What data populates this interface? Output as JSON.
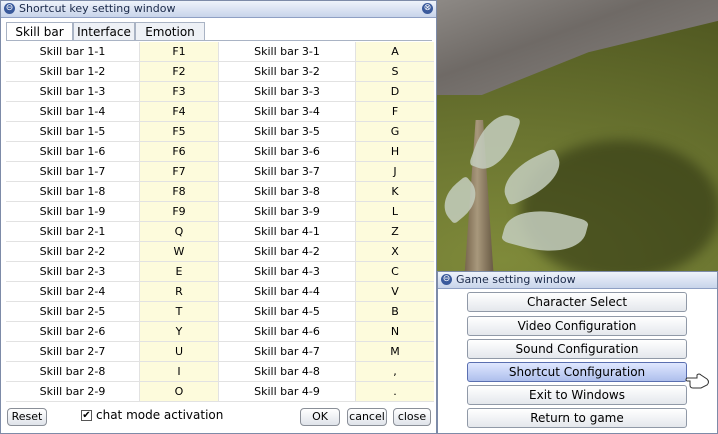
{
  "shortcut_window": {
    "title": "Shortcut key setting window",
    "tabs": [
      "Skill bar",
      "Interface",
      "Emotion"
    ],
    "active_tab": "Skill bar",
    "rows": [
      [
        "Skill bar 1-1",
        "F1",
        "Skill bar 3-1",
        "A"
      ],
      [
        "Skill bar 1-2",
        "F2",
        "Skill bar 3-2",
        "S"
      ],
      [
        "Skill bar 1-3",
        "F3",
        "Skill bar 3-3",
        "D"
      ],
      [
        "Skill bar 1-4",
        "F4",
        "Skill bar 3-4",
        "F"
      ],
      [
        "Skill bar 1-5",
        "F5",
        "Skill bar 3-5",
        "G"
      ],
      [
        "Skill bar 1-6",
        "F6",
        "Skill bar 3-6",
        "H"
      ],
      [
        "Skill bar 1-7",
        "F7",
        "Skill bar 3-7",
        "J"
      ],
      [
        "Skill bar 1-8",
        "F8",
        "Skill bar 3-8",
        "K"
      ],
      [
        "Skill bar 1-9",
        "F9",
        "Skill bar 3-9",
        "L"
      ],
      [
        "Skill bar 2-1",
        "Q",
        "Skill bar 4-1",
        "Z"
      ],
      [
        "Skill bar 2-2",
        "W",
        "Skill bar 4-2",
        "X"
      ],
      [
        "Skill bar 2-3",
        "E",
        "Skill bar 4-3",
        "C"
      ],
      [
        "Skill bar 2-4",
        "R",
        "Skill bar 4-4",
        "V"
      ],
      [
        "Skill bar 2-5",
        "T",
        "Skill bar 4-5",
        "B"
      ],
      [
        "Skill bar 2-6",
        "Y",
        "Skill bar 4-6",
        "N"
      ],
      [
        "Skill bar 2-7",
        "U",
        "Skill bar 4-7",
        "M"
      ],
      [
        "Skill bar 2-8",
        "I",
        "Skill bar 4-8",
        ","
      ],
      [
        "Skill bar 2-9",
        "O",
        "Skill bar 4-9",
        "."
      ]
    ],
    "reset_label": "Reset",
    "chat_mode_label": "chat mode activation",
    "chat_mode_checked": true,
    "ok_label": "OK",
    "cancel_label": "cancel",
    "close_label": "close"
  },
  "game_setting_window": {
    "title": "Game setting window",
    "buttons": [
      "Character Select",
      "Video Configuration",
      "Sound Configuration",
      "Shortcut Configuration",
      "Exit to Windows",
      "Return to game"
    ],
    "highlighted": "Shortcut Configuration"
  },
  "icons": {
    "window_icon": "window-icon",
    "close_icon": "close-icon",
    "cursor": "hand-pointer-icon"
  }
}
